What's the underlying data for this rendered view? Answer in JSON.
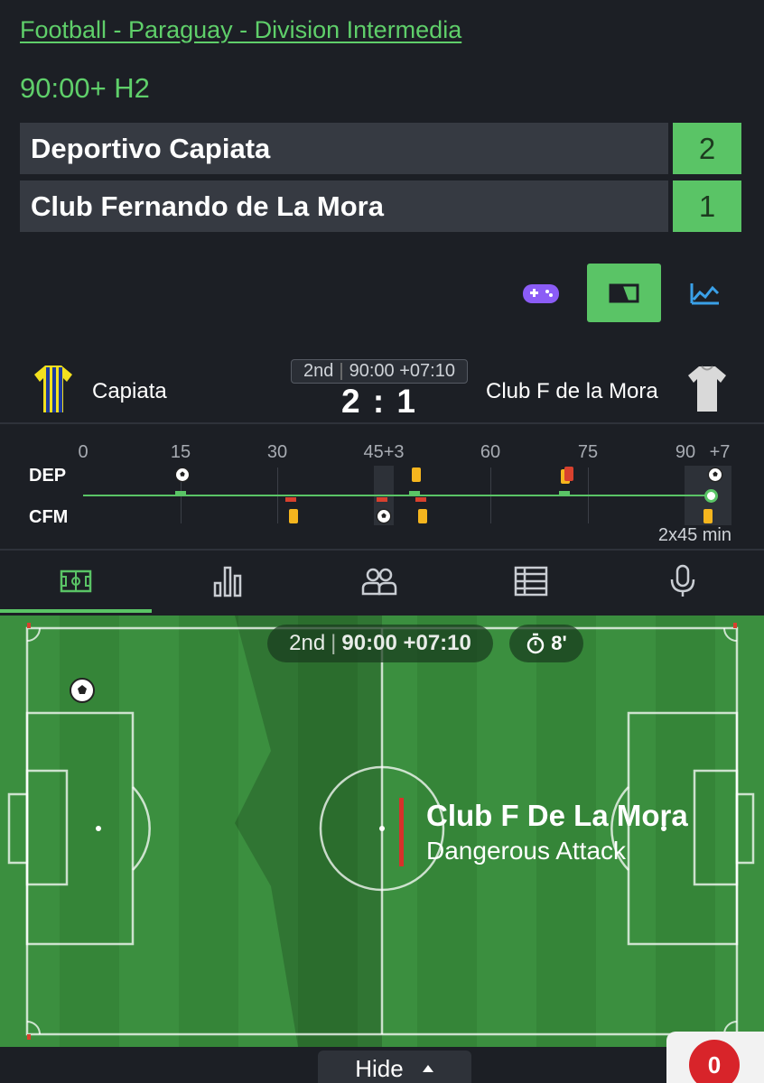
{
  "breadcrumb": "Football - Paraguay - Division Intermedia",
  "match_time": "90:00+ H2",
  "teams": [
    {
      "name": "Deportivo Capiata",
      "score": "2"
    },
    {
      "name": "Club Fernando de La Mora",
      "score": "1"
    }
  ],
  "toolbar": {
    "icons": [
      "gamepad-icon",
      "live-stream-icon",
      "stats-chart-icon"
    ],
    "active_index": 1
  },
  "scoreboard": {
    "home_short": "Capiata",
    "away_short": "Club F de la Mora",
    "period": "2nd",
    "clock": "90:00 +07:10",
    "score": "2 : 1"
  },
  "timeline": {
    "ticks": [
      "0",
      "15",
      "30",
      "45+3",
      "60",
      "75",
      "90",
      "+7"
    ],
    "home_label": "DEP",
    "away_label": "CFM",
    "duration": "2x45 min"
  },
  "tabs": [
    "pitch-tab",
    "stats-tab",
    "lineups-tab",
    "list-tab",
    "commentary-tab"
  ],
  "pitch": {
    "period": "2nd",
    "clock": "90:00 +07:10",
    "timer": "8'",
    "attack_team": "Club F De La Mora",
    "attack_type": "Dangerous Attack"
  },
  "footer": {
    "hide_label": "Hide",
    "betslip_count": "0"
  },
  "colors": {
    "accent": "#5ac466",
    "background": "#1c1f25",
    "yellow_card": "#f5b51e",
    "red_card": "#d8412e"
  }
}
